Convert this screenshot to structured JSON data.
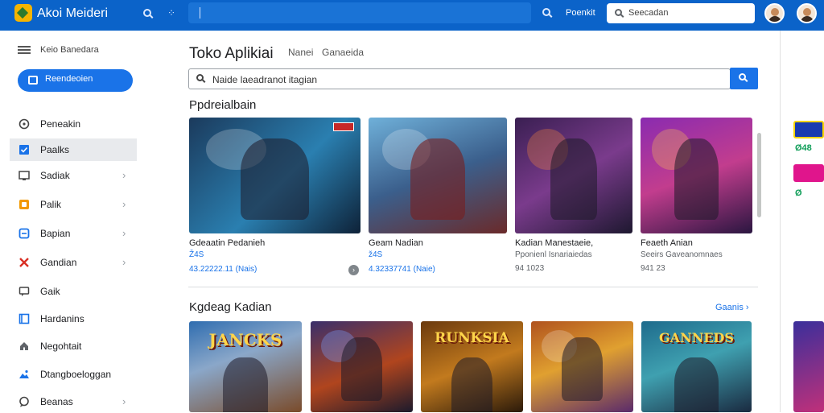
{
  "topbar": {
    "app_title": "Akoi Meideri",
    "link": "Poenkit",
    "search_placeholder": "Seecadan"
  },
  "sidebar": {
    "header": "Keio Banedara",
    "primary_button": "Reendeoien",
    "items": [
      {
        "label": "Peneakin",
        "icon": "compass-icon",
        "chevron": false,
        "active": false
      },
      {
        "label": "Paalks",
        "icon": "checkbox-icon",
        "chevron": false,
        "active": true
      },
      {
        "label": "Sadiak",
        "icon": "monitor-icon",
        "chevron": true,
        "active": false
      },
      {
        "label": "Palik",
        "icon": "tag-icon",
        "chevron": true,
        "active": false
      },
      {
        "label": "Bapian",
        "icon": "box-icon",
        "chevron": true,
        "active": false
      },
      {
        "label": "Gandian",
        "icon": "swords-icon",
        "chevron": true,
        "active": false
      },
      {
        "label": "Gaik",
        "icon": "chat-icon",
        "chevron": false,
        "active": false
      },
      {
        "label": "Hardanins",
        "icon": "book-icon",
        "chevron": false,
        "active": false
      },
      {
        "label": "Negohtait",
        "icon": "house-icon",
        "chevron": false,
        "active": false
      },
      {
        "label": "Dtangboeloggan",
        "icon": "image-icon",
        "chevron": false,
        "active": false
      },
      {
        "label": "Beanas",
        "icon": "chat-bubble-icon",
        "chevron": true,
        "active": false
      }
    ]
  },
  "main": {
    "title": "Toko Aplikiai",
    "tabs": [
      "Nanei",
      "Ganaeida"
    ],
    "search_value": "Naide laeadranot itagian",
    "section1_title": "Ppdreialbain",
    "section2_title": "Kgdeag Kadian",
    "see_all": "Gaanis",
    "cards_row1": [
      {
        "name": "Gdeaatin Pedanieh",
        "sub": "Ž4S",
        "meta": "43.22222.11 (Nais)"
      },
      {
        "name": "Geam Nadian",
        "sub": "ž4S",
        "meta": "4.32337741 (Naie)"
      },
      {
        "name": "Kadian Manestaeie,",
        "sub": "Pponienl Isnariaiedas",
        "meta": "94 1023"
      },
      {
        "name": "Feaeth Anian",
        "sub": "Seeirs Gaveanomnaes",
        "meta": "941 23"
      }
    ],
    "cards_row2": [
      {
        "art_title": "JANCKS"
      },
      {
        "art_title": ""
      },
      {
        "art_title": "RUNKSIA"
      },
      {
        "art_title": ""
      },
      {
        "art_title": "GANNEDS"
      }
    ]
  },
  "right_peek": {
    "label1": "Ø48",
    "label2": "Ø"
  },
  "colors": {
    "topbar": "#0b63c9",
    "accent": "#1a73e8",
    "active_nav": "#e8eaed"
  }
}
